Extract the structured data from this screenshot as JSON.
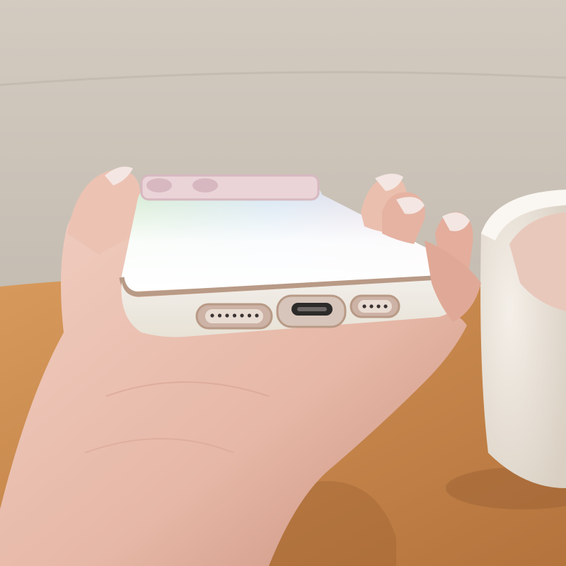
{
  "scene": {
    "subject": "phone-case-bottom-view",
    "palette": {
      "backdrop_top": "#d3cbc0",
      "backdrop_mid": "#c4bcb1",
      "table_light": "#d89a5c",
      "table_dark": "#b4733c",
      "skin_light": "#f1cfc2",
      "skin_mid": "#e6b7a6",
      "skin_shadow": "#c88e7c",
      "nail": "#f4e6e2",
      "case_white": "#f3f0ec",
      "case_edge": "#e8e2d6",
      "chrome_trim": "#b89a86",
      "rainbow_green": "#cfe9c8",
      "rainbow_blue": "#cfe1f0",
      "rainbow_pink": "#f0d2dc",
      "cup_white": "#f4efe8",
      "cup_shadow": "#d9cfc2",
      "coffee_pink": "#e9c8bc"
    },
    "parts": {
      "case_bottom_openings": [
        "speaker-grille-left",
        "charging-port-cutout",
        "speaker-grille-right"
      ],
      "camera_ring_color": "#d7b8c0"
    }
  }
}
